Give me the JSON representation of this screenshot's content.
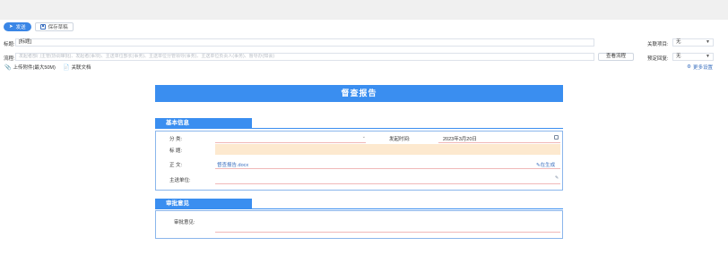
{
  "toolbar": {
    "send_label": "发送",
    "save_label": "保存草稿"
  },
  "form": {
    "title_label": "标题:",
    "title_value": "[标题]",
    "flow_label": "流程:",
    "flow_value": "发起者部门主管(协调审批)、发起者(事项)、主送单位部长(事务)、主送单位分管领导(事务)、主送单位负责人(事务)、督导办(知会)",
    "view_flow_button": "查看流程",
    "related_item_label": "关联项目:",
    "related_item_value": "无",
    "expected_reply_label": "预定回复:",
    "expected_reply_value": "无",
    "upload_label": "上传附件(最大50M)",
    "related_doc_label": "关联文档",
    "more_settings_label": "更多设置"
  },
  "document": {
    "banner": "督查报告",
    "basic_info": {
      "section_title": "基本信息",
      "category_label": "分 类:",
      "category_value": "",
      "start_time_label": "发起时间:",
      "start_time_value": "2023年3月20日",
      "title_label": "标 题:",
      "title_value": "",
      "body_label": "正 文:",
      "body_value": "督查报告.docx",
      "body_action": "在生成",
      "main_unit_label": "主送单位:",
      "main_unit_value": ""
    },
    "approval": {
      "section_title": "审批意见",
      "opinion_label": "审批意见:",
      "opinion_value": ""
    }
  },
  "colors": {
    "accent": "#3a8ef0",
    "send_button": "#3a86e6",
    "highlight": "#fde9cf",
    "link": "#3a6fbf",
    "field_underline": "#f0b8b8"
  },
  "icons": [
    "send-icon",
    "save-icon",
    "chevron-down-icon",
    "paperclip-icon",
    "document-icon",
    "gear-icon",
    "calendar-icon",
    "edit-icon",
    "unit-picker-icon"
  ]
}
